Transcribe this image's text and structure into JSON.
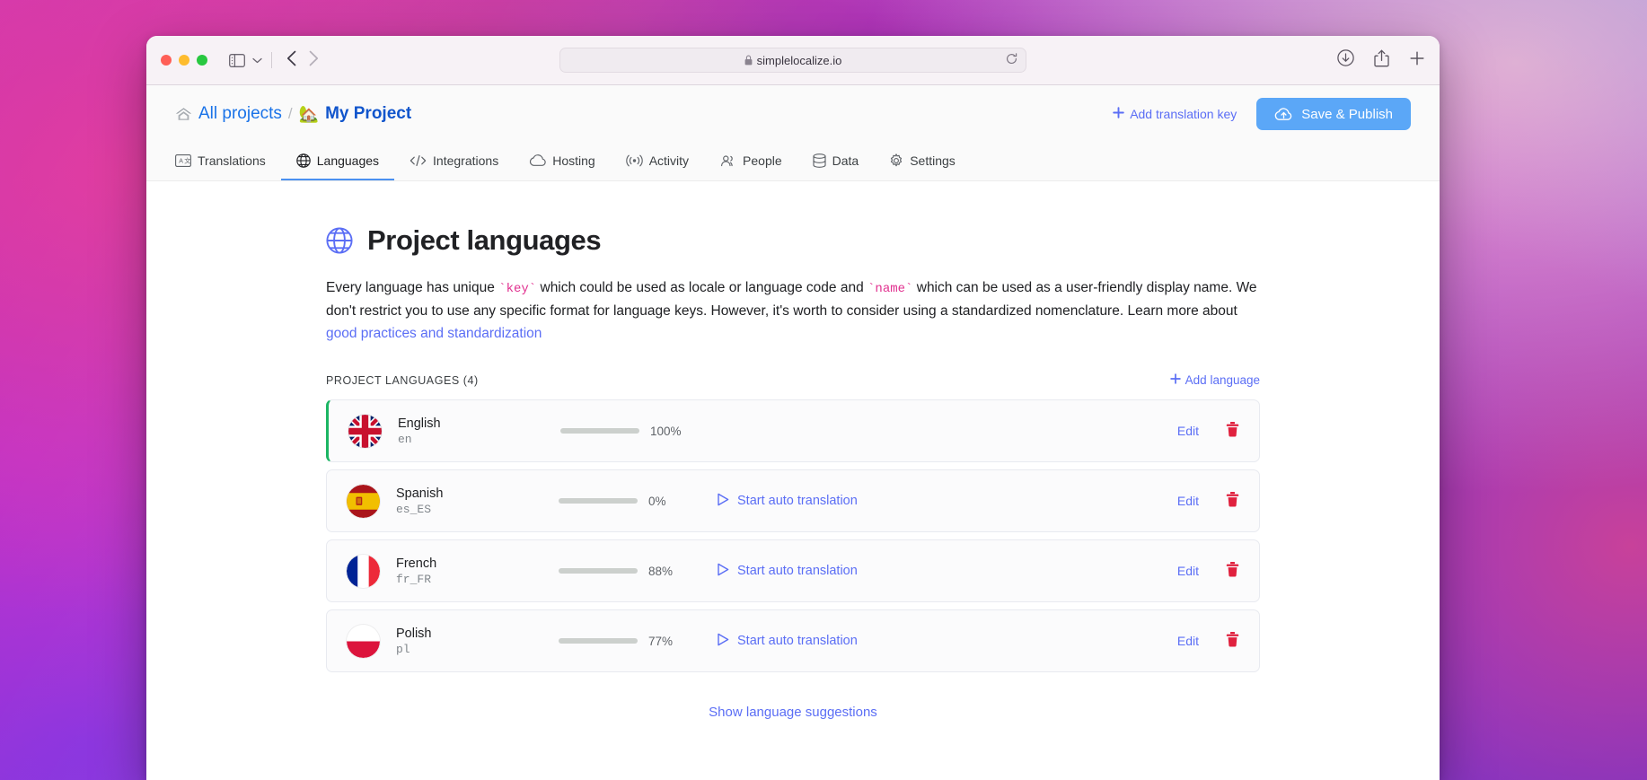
{
  "browser": {
    "url": "simplelocalize.io",
    "lock_icon": "lock-icon",
    "reload_icon": "reload-icon",
    "sidebar_icon": "sidebar-toggle-icon",
    "back_icon": "back-arrow-icon",
    "forward_icon": "forward-arrow-icon",
    "download_icon": "download-icon",
    "share_icon": "share-icon",
    "newtab_icon": "plus-icon",
    "traffic_lights": [
      "close",
      "minimize",
      "zoom"
    ]
  },
  "header": {
    "breadcrumb": {
      "home_icon": "home-icon",
      "all_projects": "All projects",
      "separator": "/",
      "project_emoji": "🏡",
      "project_name": "My Project"
    },
    "add_translation_key": "Add translation key",
    "add_translation_key_plus": "+",
    "save_publish": "Save & Publish",
    "save_publish_icon": "cloud-upload-icon"
  },
  "tabs": [
    {
      "label": "Translations",
      "icon": "translate-icon",
      "active": false
    },
    {
      "label": "Languages",
      "icon": "globe-icon",
      "active": true
    },
    {
      "label": "Integrations",
      "icon": "code-brackets-icon",
      "active": false
    },
    {
      "label": "Hosting",
      "icon": "cloud-icon",
      "active": false
    },
    {
      "label": "Activity",
      "icon": "broadcast-icon",
      "active": false
    },
    {
      "label": "People",
      "icon": "people-icon",
      "active": false
    },
    {
      "label": "Data",
      "icon": "database-icon",
      "active": false
    },
    {
      "label": "Settings",
      "icon": "gear-icon",
      "active": false
    }
  ],
  "main": {
    "title": "Project languages",
    "title_icon": "globe-icon",
    "intro": {
      "part1": "Every language has unique ",
      "code1": "`key`",
      "part2": " which could be used as locale or language code and ",
      "code2": "`name`",
      "part3": " which can be used as a user-friendly display name. We don't restrict you to use any specific format for language keys. However, it's worth to consider using a standardized nomenclature. Learn more about ",
      "link": "good practices and standardization"
    },
    "list_header": "PROJECT LANGUAGES (4)",
    "add_language": "Add language",
    "add_language_plus": "+",
    "languages": [
      {
        "name": "English",
        "code": "en",
        "flag": "flag-uk",
        "progress": 100,
        "progress_label": "100%",
        "auto_translate": "",
        "show_auto_translate": false,
        "is_primary": true,
        "edit": "Edit",
        "delete_icon": "trash-icon"
      },
      {
        "name": "Spanish",
        "code": "es_ES",
        "flag": "flag-spain",
        "progress": 0,
        "progress_label": "0%",
        "auto_translate": "Start auto translation",
        "show_auto_translate": true,
        "is_primary": false,
        "edit": "Edit",
        "delete_icon": "trash-icon"
      },
      {
        "name": "French",
        "code": "fr_FR",
        "flag": "flag-france",
        "progress": 88,
        "progress_label": "88%",
        "auto_translate": "Start auto translation",
        "show_auto_translate": true,
        "is_primary": false,
        "edit": "Edit",
        "delete_icon": "trash-icon"
      },
      {
        "name": "Polish",
        "code": "pl",
        "flag": "flag-poland",
        "progress": 77,
        "progress_label": "77%",
        "auto_translate": "Start auto translation",
        "show_auto_translate": true,
        "is_primary": false,
        "edit": "Edit",
        "delete_icon": "trash-icon"
      }
    ],
    "show_suggestions": "Show language suggestions"
  },
  "colors": {
    "accent": "#5b6ef5",
    "primary_button": "#5ba7f7",
    "progress_green": "#19b35c",
    "progress_track": "#ccd0cd",
    "delete_red": "#e0213e",
    "code_pink": "#e1308f",
    "primary_row_marker": "#1bb563"
  }
}
